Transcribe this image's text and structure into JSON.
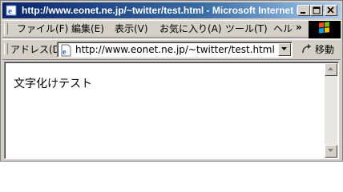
{
  "window": {
    "title": "http://www.eonet.ne.jp/~twitter/test.html - Microsoft Internet Expl...",
    "title_bar_color": "#0a246a"
  },
  "menu": {
    "items": [
      {
        "label": "ファイル(F)"
      },
      {
        "label": "編集(E)"
      },
      {
        "label": "表示(V)"
      },
      {
        "label": "お気に入り(A)"
      },
      {
        "label": "ツール(T)"
      },
      {
        "label": "ヘルプ"
      }
    ],
    "overflow": "»"
  },
  "address": {
    "label": "アドレス(D)",
    "url": "http://www.eonet.ne.jp/~twitter/test.html",
    "go_label": "移動"
  },
  "content": {
    "text": "文字化けテスト"
  },
  "icons": {
    "title": "ie-icon",
    "page": "page-icon",
    "go": "go-arrow-icon",
    "windows": "windows-logo-icon"
  }
}
